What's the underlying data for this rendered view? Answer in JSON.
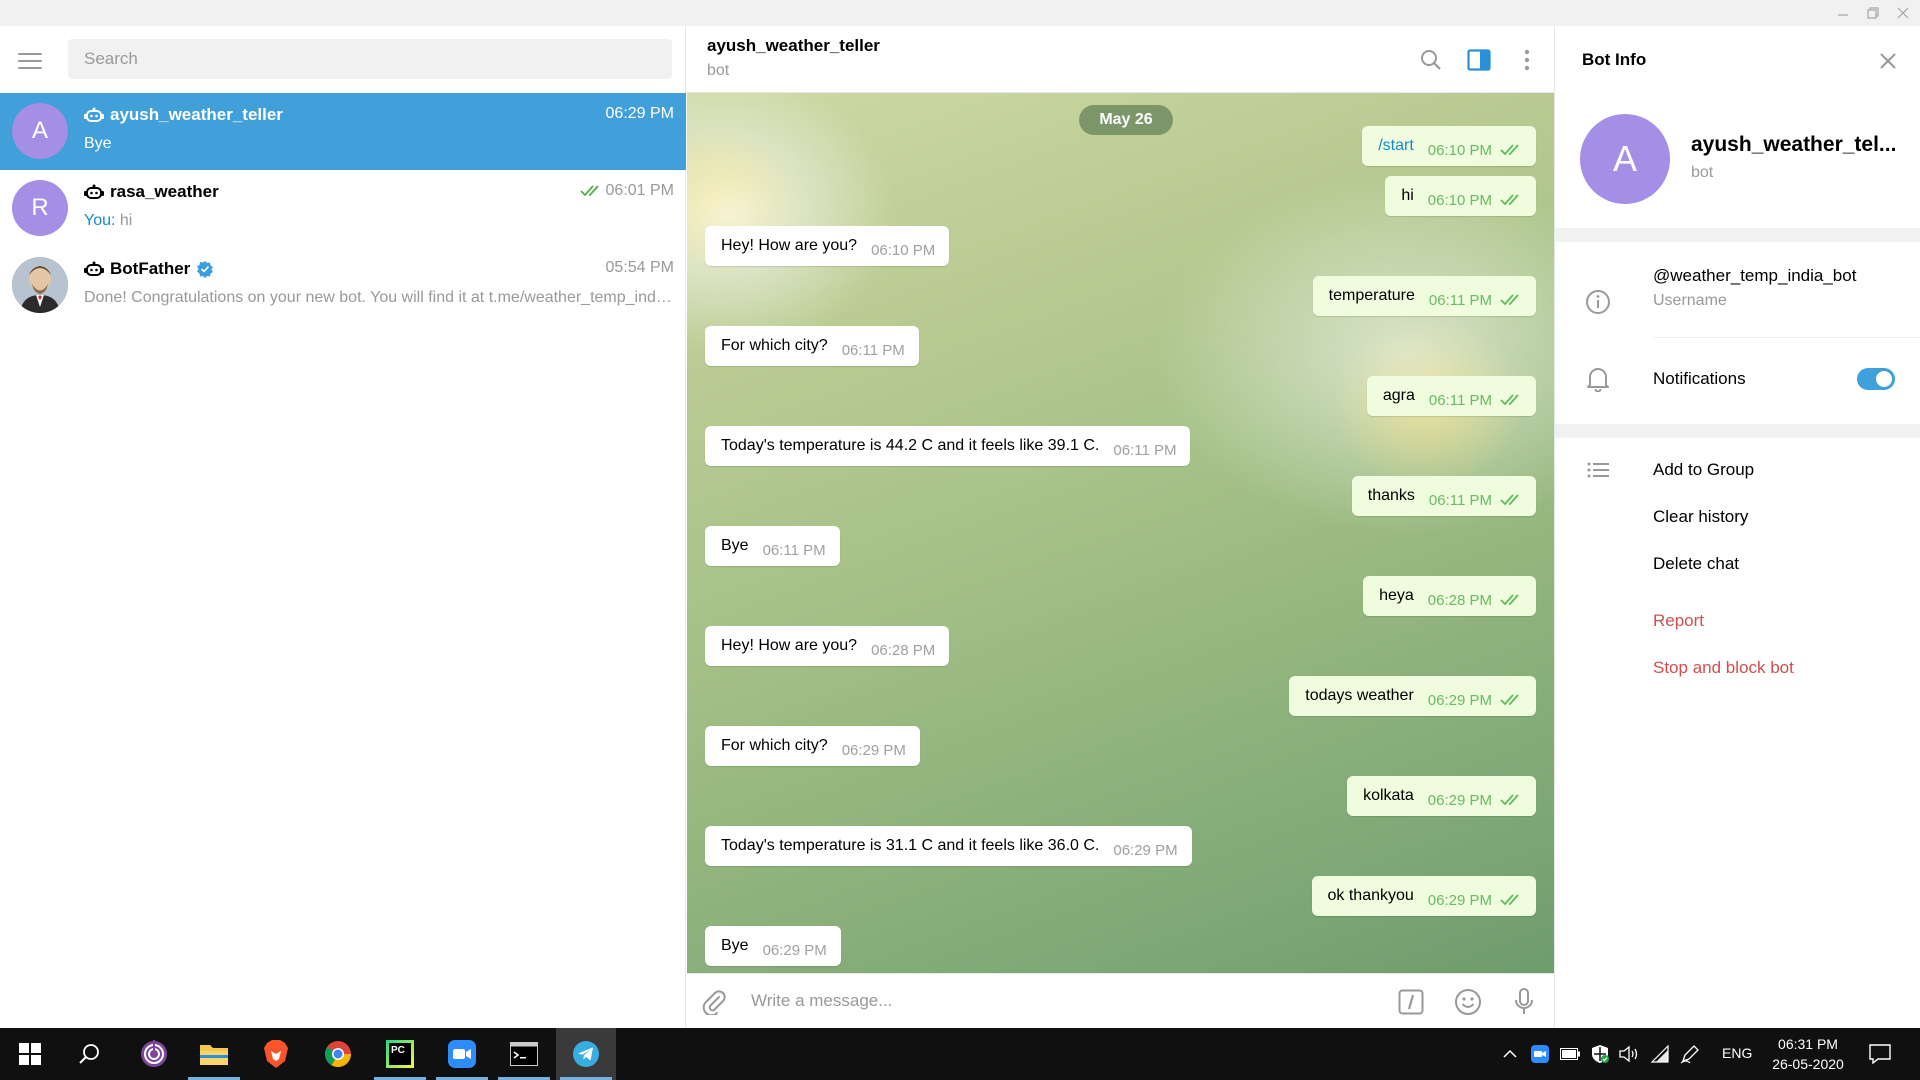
{
  "window": {
    "controls": [
      "minimize",
      "maximize",
      "close"
    ]
  },
  "sidebar": {
    "search_placeholder": "Search",
    "chats": [
      {
        "avatar_letter": "A",
        "avatar_color": "#a58ee6",
        "name": "ayush_weather_teller",
        "time": "06:29 PM",
        "preview": "Bye",
        "active": true,
        "is_bot": true
      },
      {
        "avatar_letter": "R",
        "avatar_color": "#a58ee6",
        "name": "rasa_weather",
        "time": "06:01 PM",
        "preview_prefix": "You:",
        "preview": " hi",
        "read": true,
        "is_bot": true
      },
      {
        "name": "BotFather",
        "verified": true,
        "time": "05:54 PM",
        "preview": "Done! Congratulations on your new bot. You will find it at t.me/weather_temp_india_bot. You can now add a description...",
        "is_bot": true
      }
    ]
  },
  "chat": {
    "title": "ayush_weather_teller",
    "status": "bot",
    "date_label": "May 26",
    "messages": [
      {
        "dir": "out",
        "text": "/start",
        "time": "06:10 PM",
        "command": true
      },
      {
        "dir": "out",
        "text": "hi",
        "time": "06:10 PM"
      },
      {
        "dir": "in",
        "text": "Hey! How are you?",
        "time": "06:10 PM"
      },
      {
        "dir": "out",
        "text": "temperature",
        "time": "06:11 PM"
      },
      {
        "dir": "in",
        "text": "For which city?",
        "time": "06:11 PM"
      },
      {
        "dir": "out",
        "text": "agra",
        "time": "06:11 PM"
      },
      {
        "dir": "in",
        "text": "Today's temperature is 44.2 C and it feels like 39.1 C.",
        "time": "06:11 PM"
      },
      {
        "dir": "out",
        "text": "thanks",
        "time": "06:11 PM"
      },
      {
        "dir": "in",
        "text": "Bye",
        "time": "06:11 PM"
      },
      {
        "dir": "out",
        "text": "heya",
        "time": "06:28 PM"
      },
      {
        "dir": "in",
        "text": "Hey! How are you?",
        "time": "06:28 PM"
      },
      {
        "dir": "out",
        "text": "todays weather",
        "time": "06:29 PM"
      },
      {
        "dir": "in",
        "text": "For which city?",
        "time": "06:29 PM"
      },
      {
        "dir": "out",
        "text": "kolkata",
        "time": "06:29 PM"
      },
      {
        "dir": "in",
        "text": "Today's temperature is 31.1 C and it feels like 36.0 C.",
        "time": "06:29 PM"
      },
      {
        "dir": "out",
        "text": "ok thankyou",
        "time": "06:29 PM"
      },
      {
        "dir": "in",
        "text": "Bye",
        "time": "06:29 PM"
      }
    ],
    "composer_placeholder": "Write a message..."
  },
  "info": {
    "title": "Bot Info",
    "avatar_letter": "A",
    "name": "ayush_weather_tel...",
    "status": "bot",
    "username": "@weather_temp_india_bot",
    "username_label": "Username",
    "notifications_label": "Notifications",
    "notifications_on": true,
    "actions": {
      "add_to_group": "Add to Group",
      "clear_history": "Clear history",
      "delete_chat": "Delete chat",
      "report": "Report",
      "stop_block": "Stop and block bot"
    }
  },
  "taskbar": {
    "apps": [
      "start",
      "search",
      "tor-browser",
      "file-explorer",
      "brave",
      "chrome",
      "pycharm",
      "zoom",
      "terminal",
      "telegram"
    ],
    "pycharm_label": "PC",
    "language": "ENG",
    "time": "06:31 PM",
    "date": "26-05-2020"
  },
  "colors": {
    "accent": "#419fd9",
    "out_bubble": "#effdde",
    "danger": "#d14e4e"
  }
}
